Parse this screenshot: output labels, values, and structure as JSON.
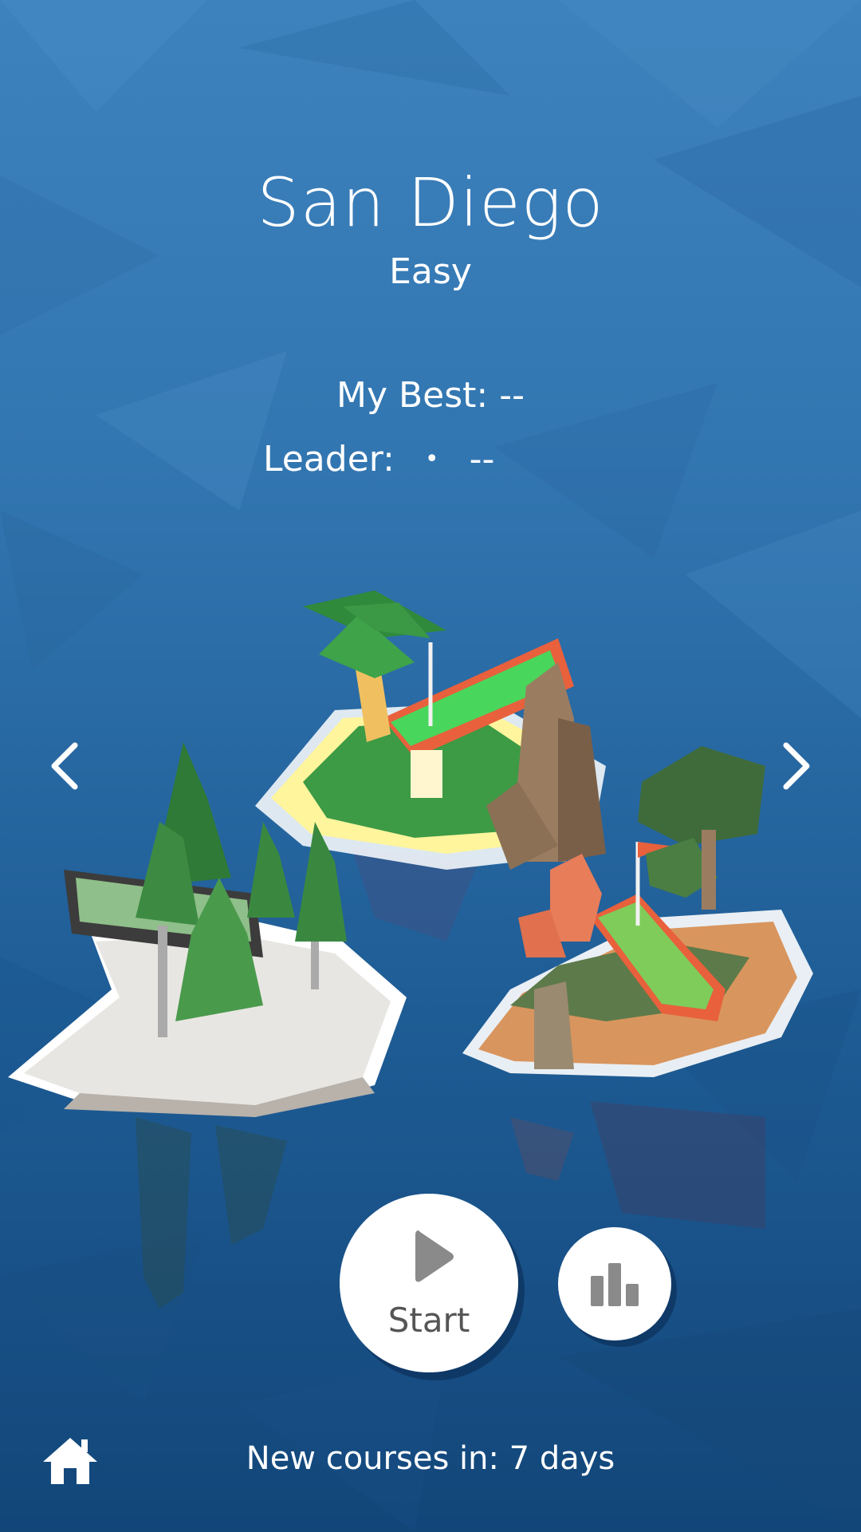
{
  "course": {
    "title": "San Diego",
    "difficulty": "Easy",
    "best_label": "My Best:",
    "best_value": "--",
    "leader_label": "Leader:",
    "leader_separator": "•",
    "leader_value": "--"
  },
  "buttons": {
    "start_label": "Start",
    "stats_icon": "bar-chart-icon",
    "home_icon": "home-icon",
    "prev_icon": "chevron-left-icon",
    "next_icon": "chevron-right-icon"
  },
  "footer": {
    "new_courses_text": "New courses in: 7 days"
  },
  "colors": {
    "water": "#3276b1",
    "button_bg": "#ffffff",
    "button_text": "#555555",
    "grass": "#49d65c",
    "rail": "#e8603c"
  }
}
